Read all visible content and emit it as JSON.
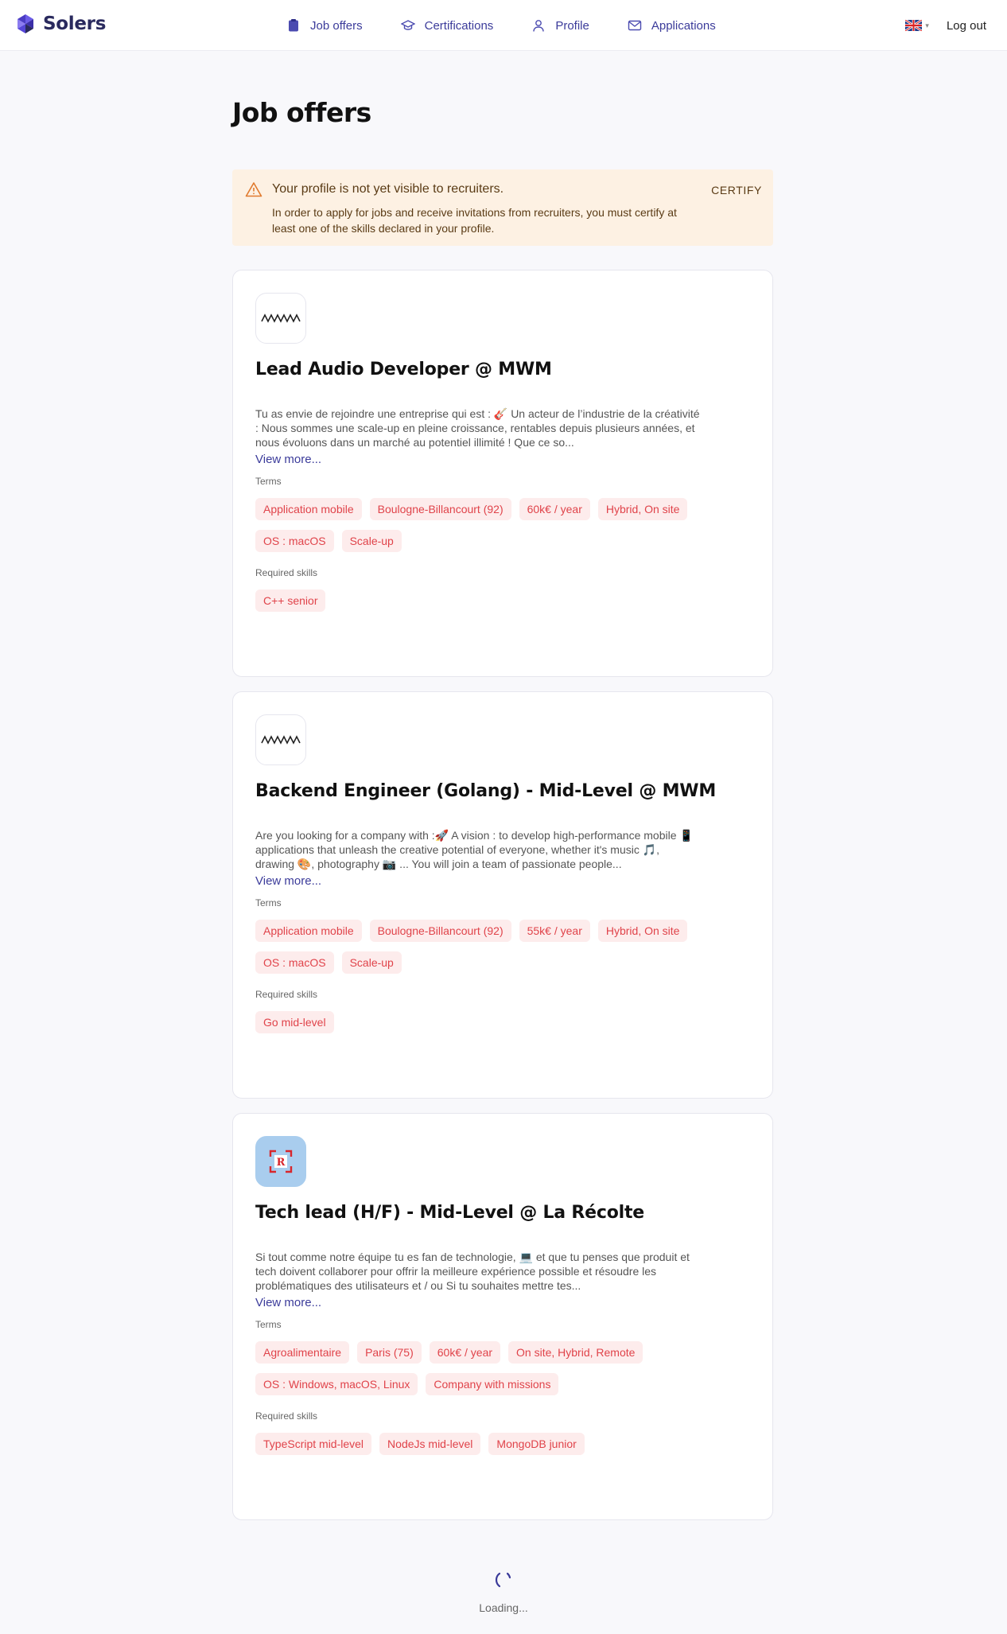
{
  "brand": {
    "name": "Solers"
  },
  "nav": {
    "items": [
      {
        "label": "Job offers",
        "icon": "clipboard-icon"
      },
      {
        "label": "Certifications",
        "icon": "graduation-cap-icon"
      },
      {
        "label": "Profile",
        "icon": "user-icon"
      },
      {
        "label": "Applications",
        "icon": "envelope-icon"
      }
    ],
    "language": "uk-flag-icon",
    "logout_label": "Log out"
  },
  "page": {
    "title": "Job offers"
  },
  "alert": {
    "title": "Your profile is not yet visible to recruiters.",
    "message": "In order to apply for jobs and receive invitations from recruiters, you must certify at least one of the skills declared in your profile.",
    "action_label": "CERTIFY"
  },
  "labels": {
    "view_more": "View more...",
    "terms": "Terms",
    "required_skills": "Required skills"
  },
  "jobs": [
    {
      "title": "Lead Audio Developer @ MWM",
      "logo": "mwm-logo",
      "description": "Tu as envie de rejoindre une entreprise qui est : 🎸 Un acteur de l’industrie de la créativité : Nous sommes une scale-up en pleine croissance, rentables depuis plusieurs années, et nous évoluons dans un marché au potentiel illimité ! Que ce so...",
      "terms": [
        "Application mobile",
        "Boulogne-Billancourt (92)",
        "60k€ / year",
        "Hybrid, On site",
        "OS : macOS",
        "Scale-up"
      ],
      "skills": [
        "C++ senior"
      ]
    },
    {
      "title": "Backend Engineer (Golang) - Mid-Level @ MWM",
      "logo": "mwm-logo",
      "description": "Are you looking for a company with :🚀 A vision : to develop high-performance mobile 📱applications that unleash the creative potential of everyone, whether it's music 🎵, drawing 🎨, photography 📷 ... You will join a team of passionate people...",
      "terms": [
        "Application mobile",
        "Boulogne-Billancourt (92)",
        "55k€ / year",
        "Hybrid, On site",
        "OS : macOS",
        "Scale-up"
      ],
      "skills": [
        "Go mid-level"
      ]
    },
    {
      "title": "Tech lead (H/F) - Mid-Level @ La Récolte",
      "logo": "la-recolte-logo",
      "description": "Si tout comme notre équipe tu es fan de technologie, 💻 et que tu penses que produit et tech doivent collaborer pour offrir la meilleure expérience possible et résoudre les problématiques des utilisateurs et / ou Si tu souhaites mettre tes...",
      "terms": [
        "Agroalimentaire",
        "Paris (75)",
        "60k€ / year",
        "On site, Hybrid, Remote",
        "OS : Windows, macOS, Linux",
        "Company with missions"
      ],
      "skills": [
        "TypeScript mid-level",
        "NodeJs mid-level",
        "MongoDB junior"
      ]
    }
  ],
  "loader": {
    "text": "Loading..."
  },
  "colors": {
    "accent": "#3b3b9a",
    "chip_bg": "#fdecec",
    "chip_text": "#e0434a",
    "alert_bg": "#fdf1e3",
    "warning": "#e07a2e"
  }
}
